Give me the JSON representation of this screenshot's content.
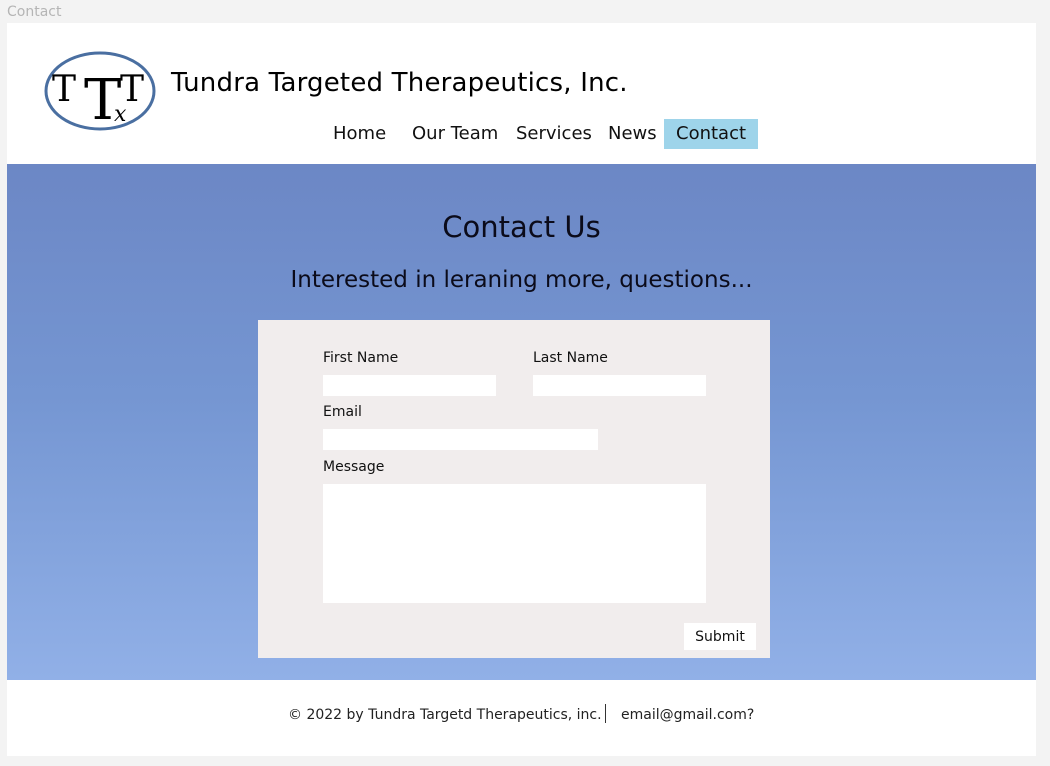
{
  "page": {
    "label": "Contact"
  },
  "header": {
    "company_name": "Tundra Targeted Therapeutics, Inc.",
    "logo_letters": {
      "left": "T",
      "center": "T",
      "right": "T",
      "subscript": "x"
    }
  },
  "nav": {
    "items": [
      {
        "label": "Home"
      },
      {
        "label": "Our Team"
      },
      {
        "label": "Services"
      },
      {
        "label": "News"
      },
      {
        "label": "Contact",
        "active": true
      }
    ]
  },
  "hero": {
    "title": "Contact Us",
    "subtitle": "Interested in leraning more, questions..."
  },
  "form": {
    "first_name_label": "First Name",
    "first_name_value": "",
    "last_name_label": "Last Name",
    "last_name_value": "",
    "email_label": "Email",
    "email_value": "",
    "message_label": "Message",
    "message_value": "",
    "submit_label": "Submit"
  },
  "footer": {
    "copyright": "© 2022 by Tundra Targetd Therapeutics, inc.",
    "email": "email@gmail.com?"
  },
  "colors": {
    "nav_active_bg": "#9ed4ea",
    "hero_gradient_top": "#6c87c5",
    "hero_gradient_bottom": "#91b0e7",
    "form_card_bg": "#f1eded",
    "logo_ring": "#4a6fa1"
  }
}
